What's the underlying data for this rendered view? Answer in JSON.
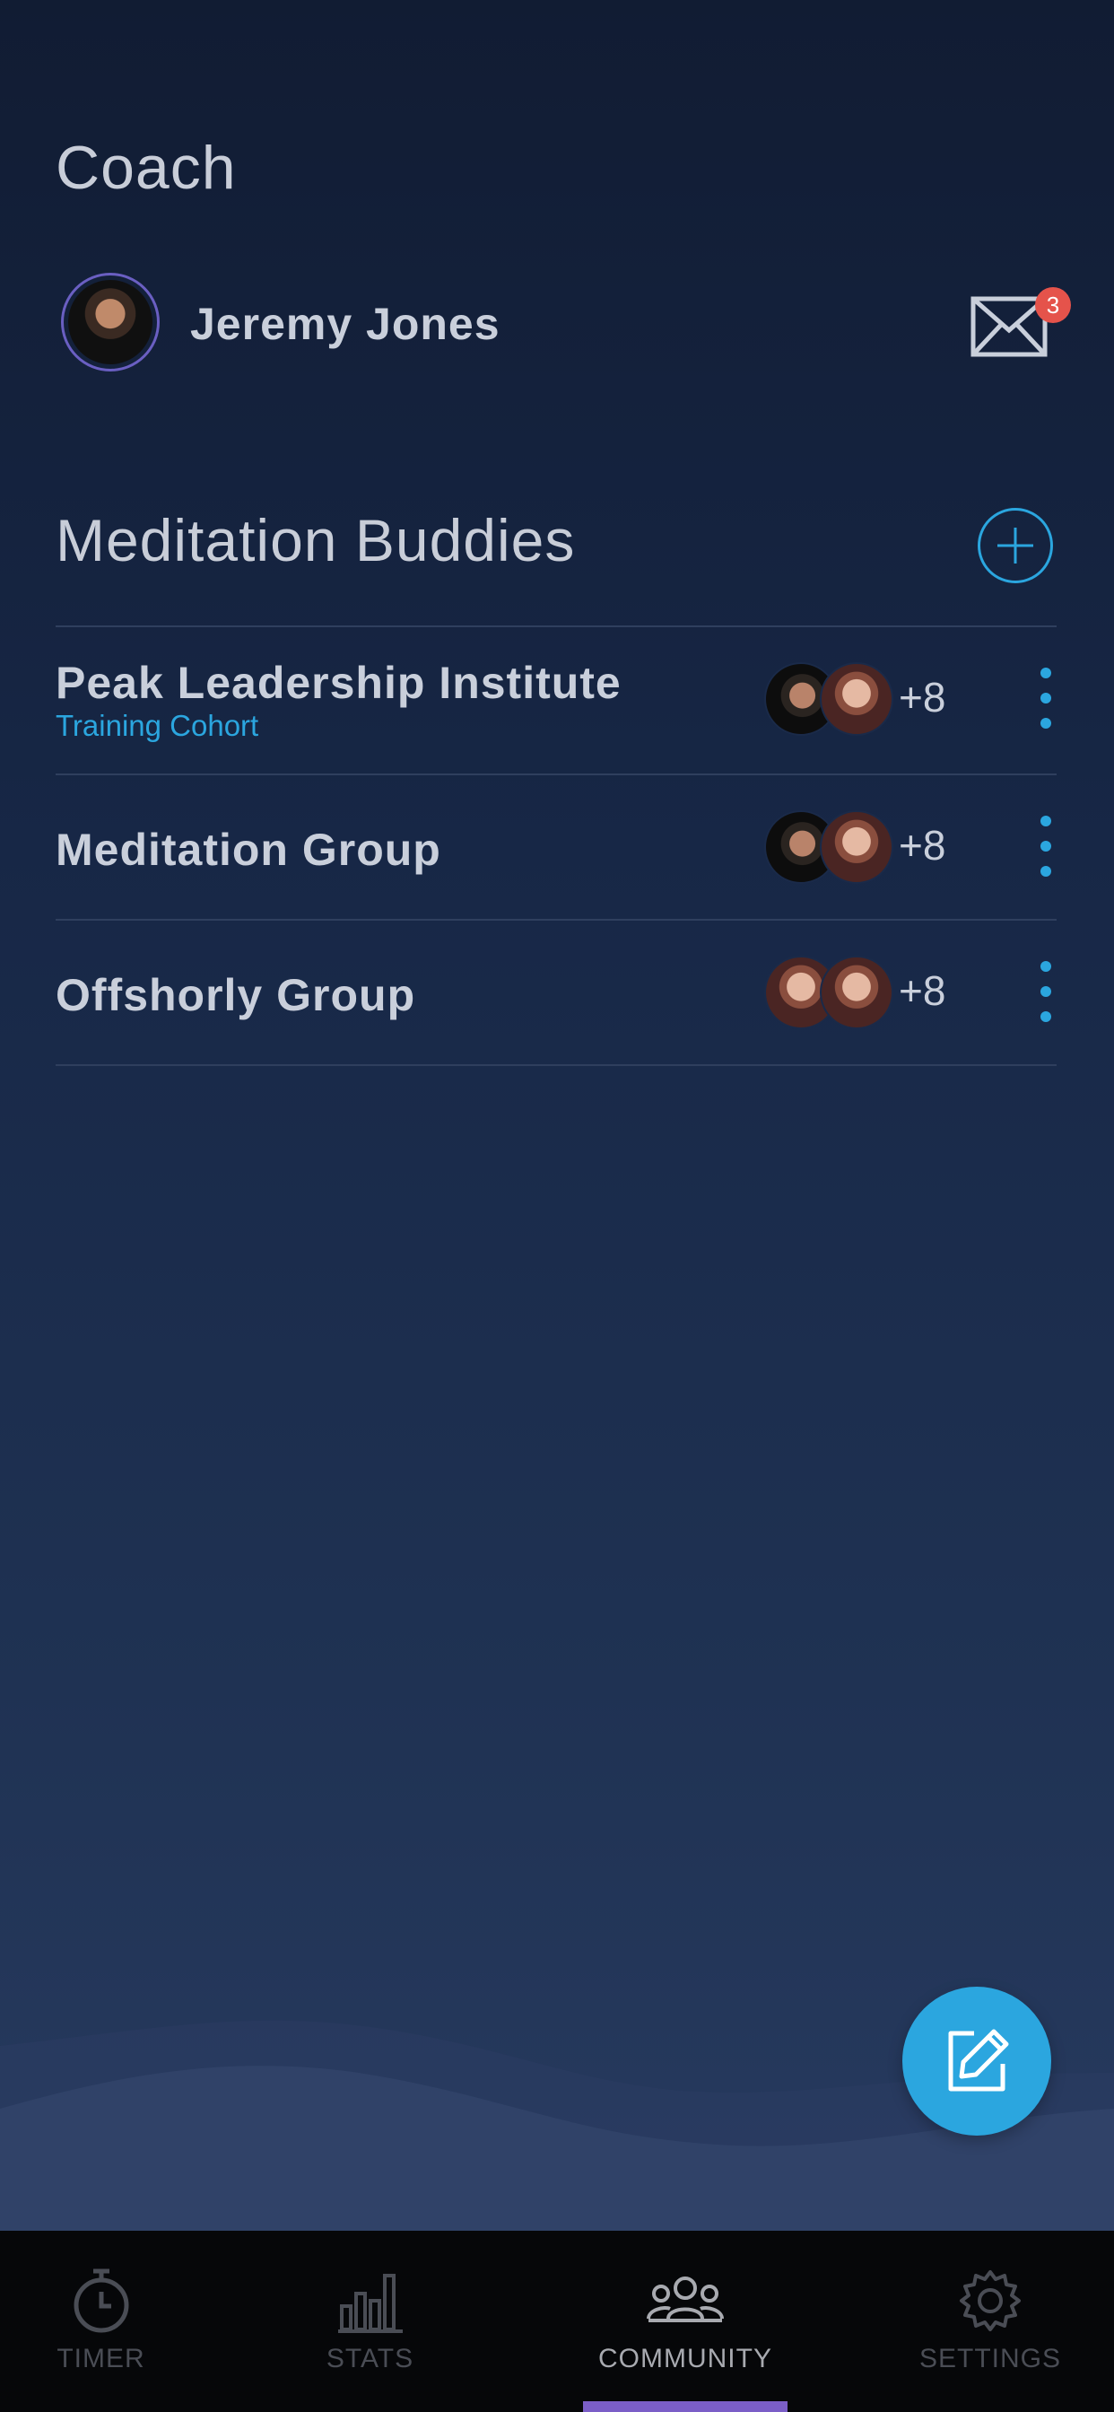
{
  "coach": {
    "section_title": "Coach",
    "name": "Jeremy Jones",
    "unread_messages": "3"
  },
  "buddies": {
    "section_title": "Meditation Buddies",
    "groups": [
      {
        "name": "Peak Leadership Institute",
        "subtitle": "Training Cohort",
        "more_count": "+8"
      },
      {
        "name": "Meditation Group",
        "subtitle": "",
        "more_count": "+8"
      },
      {
        "name": "Offshorly Group",
        "subtitle": "",
        "more_count": "+8"
      }
    ]
  },
  "tabs": [
    {
      "label": "TIMER",
      "icon": "stopwatch-icon"
    },
    {
      "label": "STATS",
      "icon": "bar-chart-icon"
    },
    {
      "label": "COMMUNITY",
      "icon": "people-icon",
      "active": true
    },
    {
      "label": "SETTINGS",
      "icon": "gear-icon"
    }
  ],
  "colors": {
    "accent": "#2ba6df",
    "badge": "#e5534b",
    "active_tab_indicator": "#7b5ec7"
  }
}
